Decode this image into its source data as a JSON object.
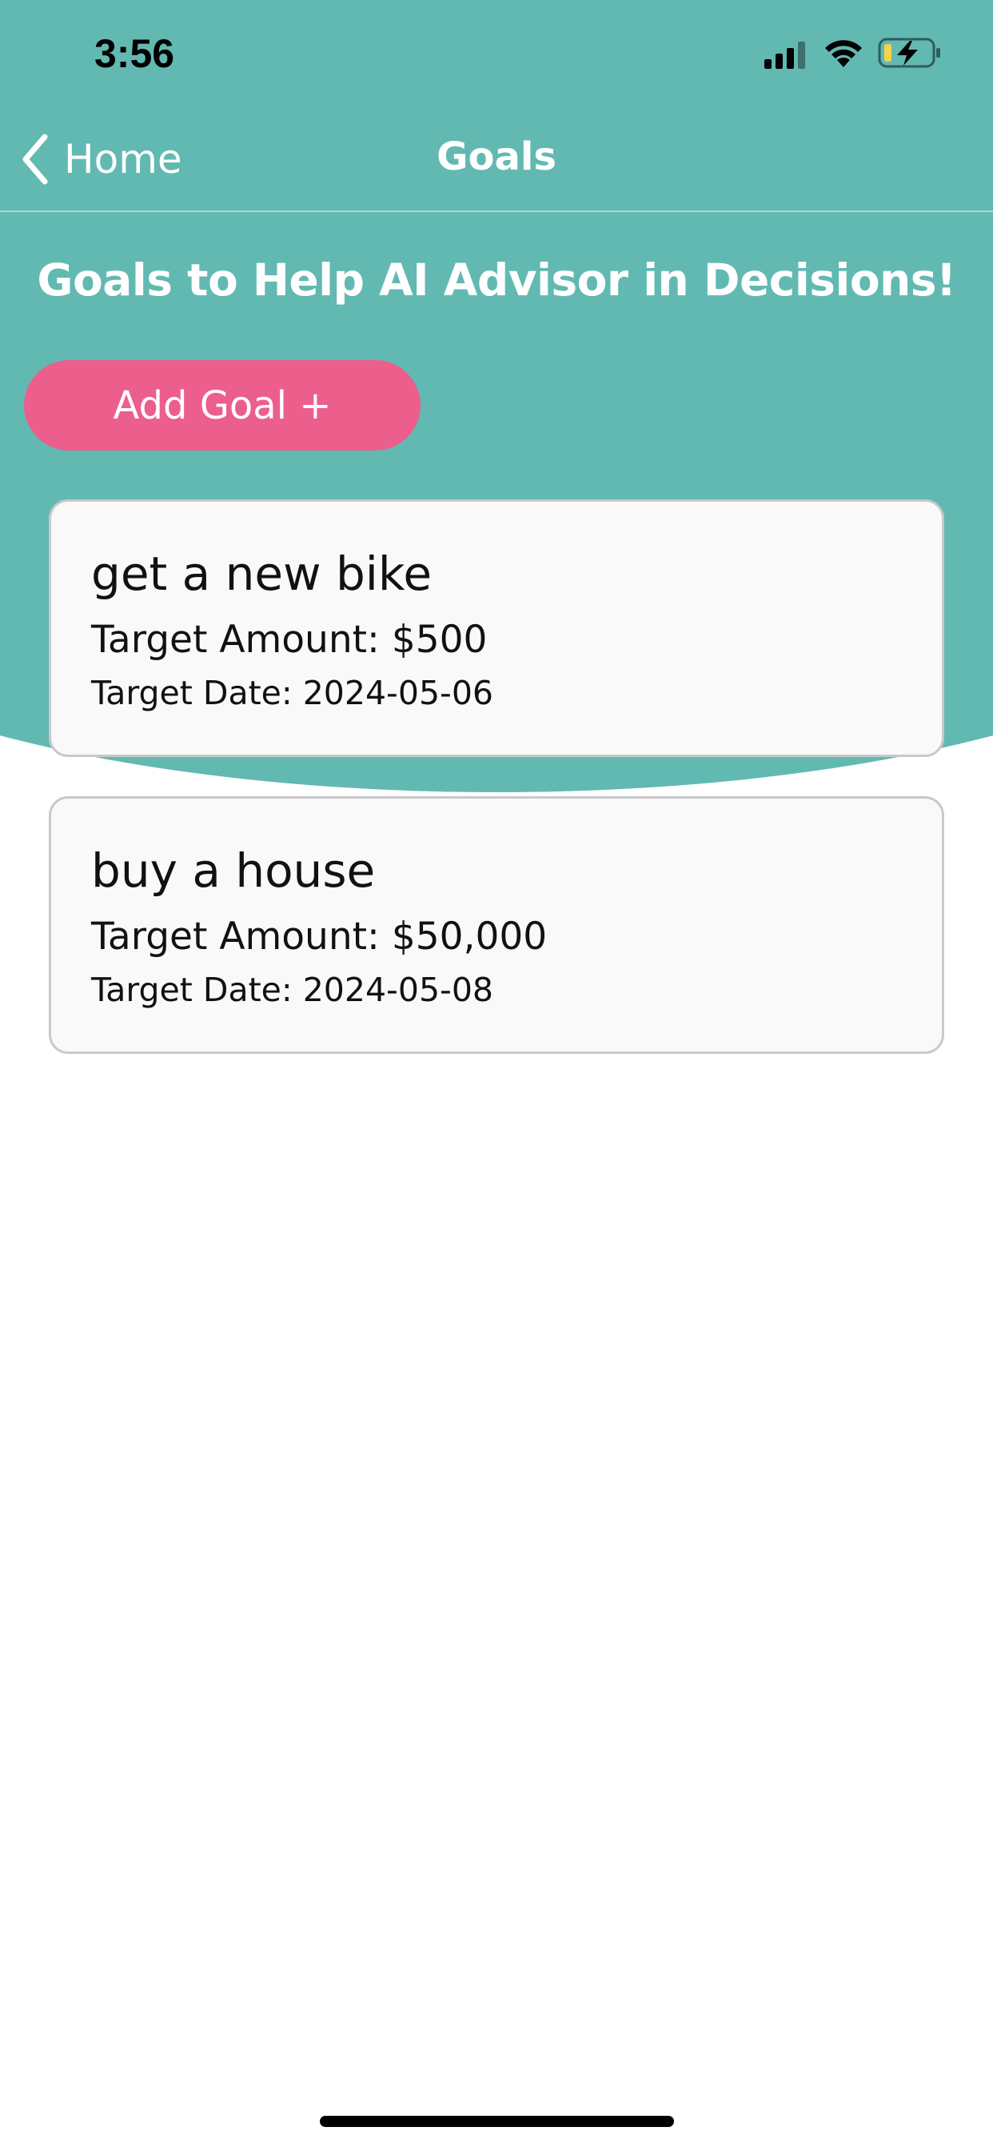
{
  "status_bar": {
    "time": "3:56",
    "icons": [
      "signal-icon",
      "wifi-icon",
      "battery-charging-icon"
    ]
  },
  "nav": {
    "back_label": "Home",
    "title": "Goals",
    "back_icon": "chevron-left-icon"
  },
  "headline": "Goals to Help AI Advisor in Decisions!",
  "add_goal_label": "Add Goal +",
  "goals": [
    {
      "title": "get a new bike",
      "amount": "Target Amount: $500",
      "date": "Target Date: 2024-05-06"
    },
    {
      "title": "buy a house",
      "amount": "Target Amount: $50,000",
      "date": "Target Date: 2024-05-08"
    }
  ],
  "colors": {
    "header_teal": "#62b9b2",
    "button_pink": "#ec5e8c",
    "card_background": "#f9f9f9",
    "card_border": "#c9c9c9",
    "battery_accent": "#f5d547"
  }
}
